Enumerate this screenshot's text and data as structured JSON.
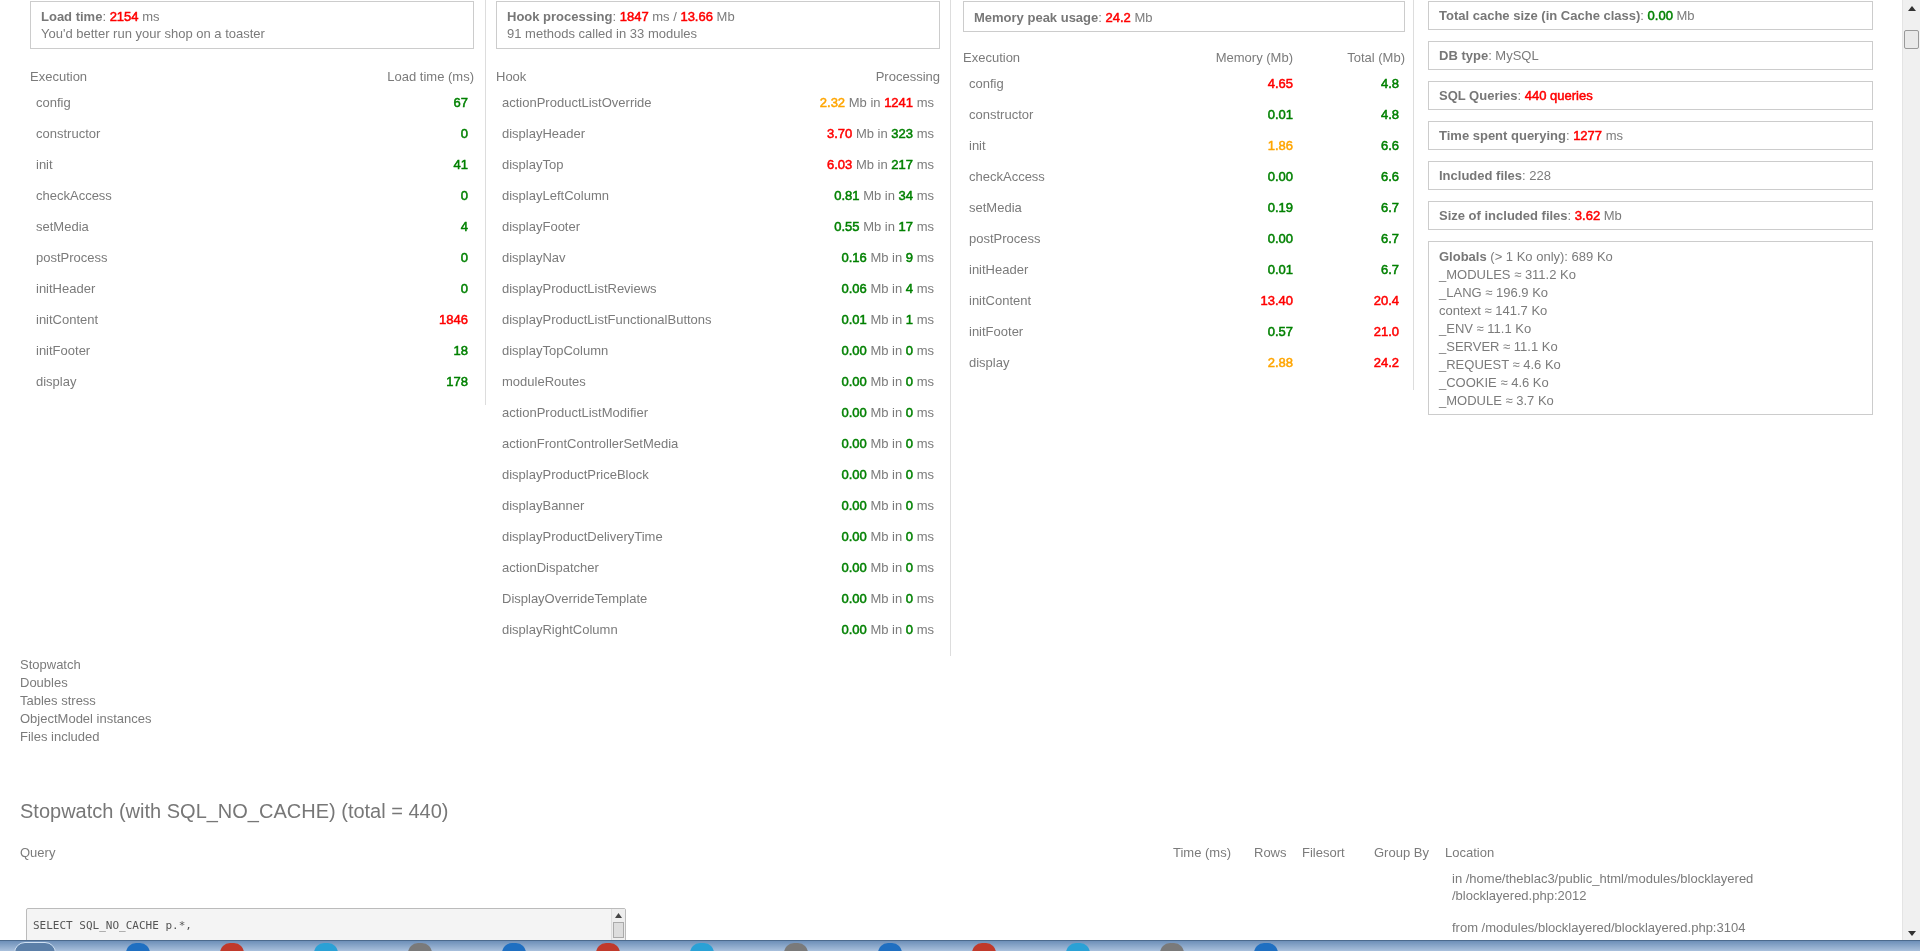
{
  "load_box": {
    "label": "Load time",
    "parts": [
      {
        "text": ": "
      },
      {
        "text": "2154",
        "color": "#ff0000"
      },
      {
        "text": " ms"
      }
    ],
    "note": "You'd better run your shop on a toaster"
  },
  "execution_table": {
    "columns": [
      "Execution",
      "Load time (ms)"
    ],
    "rows": [
      {
        "name": "config",
        "value": {
          "text": "67",
          "color": "#008000"
        }
      },
      {
        "name": "constructor",
        "value": {
          "text": "0",
          "color": "#008000"
        }
      },
      {
        "name": "init",
        "value": {
          "text": "41",
          "color": "#008000"
        }
      },
      {
        "name": "checkAccess",
        "value": {
          "text": "0",
          "color": "#008000"
        }
      },
      {
        "name": "setMedia",
        "value": {
          "text": "4",
          "color": "#008000"
        }
      },
      {
        "name": "postProcess",
        "value": {
          "text": "0",
          "color": "#008000"
        }
      },
      {
        "name": "initHeader",
        "value": {
          "text": "0",
          "color": "#008000"
        }
      },
      {
        "name": "initContent",
        "value": {
          "text": "1846",
          "color": "#ff0000"
        }
      },
      {
        "name": "initFooter",
        "value": {
          "text": "18",
          "color": "#008000"
        }
      },
      {
        "name": "display",
        "value": {
          "text": "178",
          "color": "#008000"
        }
      }
    ]
  },
  "hook_box": {
    "label": "Hook processing",
    "parts": [
      {
        "text": ": "
      },
      {
        "text": "1847",
        "color": "#ff0000"
      },
      {
        "text": " ms / "
      },
      {
        "text": "13.66",
        "color": "#ff0000"
      },
      {
        "text": " Mb"
      }
    ],
    "note": "91 methods called in 33 modules"
  },
  "hook_table": {
    "columns": [
      "Hook",
      "Processing"
    ],
    "rows": [
      {
        "name": "actionProductListOverride",
        "parts": [
          {
            "text": "2.32",
            "color": "#ffa500"
          },
          {
            "text": " Mb in "
          },
          {
            "text": "1241",
            "color": "#ff0000"
          },
          {
            "text": " ms"
          }
        ]
      },
      {
        "name": "displayHeader",
        "parts": [
          {
            "text": "3.70",
            "color": "#ff0000"
          },
          {
            "text": " Mb in "
          },
          {
            "text": "323",
            "color": "#008000"
          },
          {
            "text": " ms"
          }
        ]
      },
      {
        "name": "displayTop",
        "parts": [
          {
            "text": "6.03",
            "color": "#ff0000"
          },
          {
            "text": " Mb in "
          },
          {
            "text": "217",
            "color": "#008000"
          },
          {
            "text": " ms"
          }
        ]
      },
      {
        "name": "displayLeftColumn",
        "parts": [
          {
            "text": "0.81",
            "color": "#008000"
          },
          {
            "text": " Mb in "
          },
          {
            "text": "34",
            "color": "#008000"
          },
          {
            "text": " ms"
          }
        ]
      },
      {
        "name": "displayFooter",
        "parts": [
          {
            "text": "0.55",
            "color": "#008000"
          },
          {
            "text": " Mb in "
          },
          {
            "text": "17",
            "color": "#008000"
          },
          {
            "text": " ms"
          }
        ]
      },
      {
        "name": "displayNav",
        "parts": [
          {
            "text": "0.16",
            "color": "#008000"
          },
          {
            "text": " Mb in "
          },
          {
            "text": "9",
            "color": "#008000"
          },
          {
            "text": " ms"
          }
        ]
      },
      {
        "name": "displayProductListReviews",
        "parts": [
          {
            "text": "0.06",
            "color": "#008000"
          },
          {
            "text": " Mb in "
          },
          {
            "text": "4",
            "color": "#008000"
          },
          {
            "text": " ms"
          }
        ]
      },
      {
        "name": "displayProductListFunctionalButtons",
        "parts": [
          {
            "text": "0.01",
            "color": "#008000"
          },
          {
            "text": " Mb in "
          },
          {
            "text": "1",
            "color": "#008000"
          },
          {
            "text": " ms"
          }
        ]
      },
      {
        "name": "displayTopColumn",
        "parts": [
          {
            "text": "0.00",
            "color": "#008000"
          },
          {
            "text": " Mb in "
          },
          {
            "text": "0",
            "color": "#008000"
          },
          {
            "text": " ms"
          }
        ]
      },
      {
        "name": "moduleRoutes",
        "parts": [
          {
            "text": "0.00",
            "color": "#008000"
          },
          {
            "text": " Mb in "
          },
          {
            "text": "0",
            "color": "#008000"
          },
          {
            "text": " ms"
          }
        ]
      },
      {
        "name": "actionProductListModifier",
        "parts": [
          {
            "text": "0.00",
            "color": "#008000"
          },
          {
            "text": " Mb in "
          },
          {
            "text": "0",
            "color": "#008000"
          },
          {
            "text": " ms"
          }
        ]
      },
      {
        "name": "actionFrontControllerSetMedia",
        "parts": [
          {
            "text": "0.00",
            "color": "#008000"
          },
          {
            "text": " Mb in "
          },
          {
            "text": "0",
            "color": "#008000"
          },
          {
            "text": " ms"
          }
        ]
      },
      {
        "name": "displayProductPriceBlock",
        "parts": [
          {
            "text": "0.00",
            "color": "#008000"
          },
          {
            "text": " Mb in "
          },
          {
            "text": "0",
            "color": "#008000"
          },
          {
            "text": " ms"
          }
        ]
      },
      {
        "name": "displayBanner",
        "parts": [
          {
            "text": "0.00",
            "color": "#008000"
          },
          {
            "text": " Mb in "
          },
          {
            "text": "0",
            "color": "#008000"
          },
          {
            "text": " ms"
          }
        ]
      },
      {
        "name": "displayProductDeliveryTime",
        "parts": [
          {
            "text": "0.00",
            "color": "#008000"
          },
          {
            "text": " Mb in "
          },
          {
            "text": "0",
            "color": "#008000"
          },
          {
            "text": " ms"
          }
        ]
      },
      {
        "name": "actionDispatcher",
        "parts": [
          {
            "text": "0.00",
            "color": "#008000"
          },
          {
            "text": " Mb in "
          },
          {
            "text": "0",
            "color": "#008000"
          },
          {
            "text": " ms"
          }
        ]
      },
      {
        "name": "DisplayOverrideTemplate",
        "parts": [
          {
            "text": "0.00",
            "color": "#008000"
          },
          {
            "text": " Mb in "
          },
          {
            "text": "0",
            "color": "#008000"
          },
          {
            "text": " ms"
          }
        ]
      },
      {
        "name": "displayRightColumn",
        "parts": [
          {
            "text": "0.00",
            "color": "#008000"
          },
          {
            "text": " Mb in "
          },
          {
            "text": "0",
            "color": "#008000"
          },
          {
            "text": " ms"
          }
        ]
      }
    ]
  },
  "memory_box": {
    "label": "Memory peak usage",
    "parts": [
      {
        "text": ": "
      },
      {
        "text": "24.2",
        "color": "#ff0000"
      },
      {
        "text": " Mb"
      }
    ]
  },
  "memory_table": {
    "columns": [
      "Execution",
      "Memory (Mb)",
      "Total (Mb)"
    ],
    "rows": [
      {
        "name": "config",
        "memory": {
          "text": "4.65",
          "color": "#ff0000"
        },
        "total": {
          "text": "4.8",
          "color": "#008000"
        }
      },
      {
        "name": "constructor",
        "memory": {
          "text": "0.01",
          "color": "#008000"
        },
        "total": {
          "text": "4.8",
          "color": "#008000"
        }
      },
      {
        "name": "init",
        "memory": {
          "text": "1.86",
          "color": "#ffa500"
        },
        "total": {
          "text": "6.6",
          "color": "#008000"
        }
      },
      {
        "name": "checkAccess",
        "memory": {
          "text": "0.00",
          "color": "#008000"
        },
        "total": {
          "text": "6.6",
          "color": "#008000"
        }
      },
      {
        "name": "setMedia",
        "memory": {
          "text": "0.19",
          "color": "#008000"
        },
        "total": {
          "text": "6.7",
          "color": "#008000"
        }
      },
      {
        "name": "postProcess",
        "memory": {
          "text": "0.00",
          "color": "#008000"
        },
        "total": {
          "text": "6.7",
          "color": "#008000"
        }
      },
      {
        "name": "initHeader",
        "memory": {
          "text": "0.01",
          "color": "#008000"
        },
        "total": {
          "text": "6.7",
          "color": "#008000"
        }
      },
      {
        "name": "initContent",
        "memory": {
          "text": "13.40",
          "color": "#ff0000"
        },
        "total": {
          "text": "20.4",
          "color": "#ff0000"
        }
      },
      {
        "name": "initFooter",
        "memory": {
          "text": "0.57",
          "color": "#008000"
        },
        "total": {
          "text": "21.0",
          "color": "#ff0000"
        }
      },
      {
        "name": "display",
        "memory": {
          "text": "2.88",
          "color": "#ffa500"
        },
        "total": {
          "text": "24.2",
          "color": "#ff0000"
        }
      }
    ]
  },
  "info_boxes": [
    {
      "label": "Total cache size (in Cache class)",
      "parts": [
        {
          "text": ": "
        },
        {
          "text": "0.00",
          "color": "#008000"
        },
        {
          "text": " Mb"
        }
      ]
    },
    {
      "label": "DB type",
      "parts": [
        {
          "text": ": MySQL"
        }
      ]
    },
    {
      "label": "SQL Queries",
      "parts": [
        {
          "text": ": "
        },
        {
          "text": "440 queries",
          "color": "#ff0000"
        }
      ]
    },
    {
      "label": "Time spent querying",
      "parts": [
        {
          "text": ": "
        },
        {
          "text": "1277",
          "color": "#ff0000"
        },
        {
          "text": " ms"
        }
      ]
    },
    {
      "label": "Included files",
      "parts": [
        {
          "text": ": 228"
        }
      ]
    },
    {
      "label": "Size of included files",
      "parts": [
        {
          "text": ": "
        },
        {
          "text": "3.62",
          "color": "#ff0000"
        },
        {
          "text": " Mb"
        }
      ]
    }
  ],
  "globals_box": {
    "label": "Globals",
    "parts": [
      {
        "text": " (> 1 Ko only): 689 Ko"
      }
    ],
    "lines": [
      "_MODULES ≈ 311.2 Ko",
      "_LANG ≈ 196.9 Ko",
      "context ≈ 141.7 Ko",
      "_ENV ≈ 11.1 Ko",
      "_SERVER ≈ 11.1 Ko",
      "_REQUEST ≈ 4.6 Ko",
      "_COOKIE ≈ 4.6 Ko",
      "_MODULE ≈ 3.7 Ko"
    ]
  },
  "section_links": [
    "Stopwatch",
    "Doubles",
    "Tables stress",
    "ObjectModel instances",
    "Files included"
  ],
  "stopwatch": {
    "title": "Stopwatch (with SQL_NO_CACHE) (total = 440)",
    "columns": [
      "Query",
      "Time (ms)",
      "Rows",
      "Filesort",
      "Group By",
      "Location"
    ],
    "query": "SELECT SQL_NO_CACHE p.*,",
    "location": [
      "in /home/theblac3/public_html/modules/blocklayered",
      "/blocklayered.php:2012"
    ],
    "called_from": "from /modules/blocklayered/blocklayered.php:3104"
  }
}
